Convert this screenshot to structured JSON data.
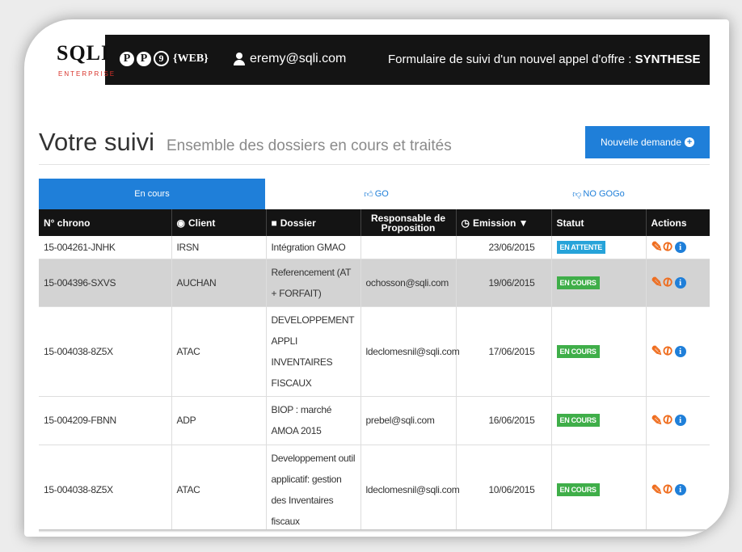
{
  "topbar": {
    "logo_text": "SQLI",
    "logo_sub": "ENTERPRISE",
    "app_logo": {
      "p1": "P",
      "p2": "P",
      "num": "9",
      "web": "{WEB}"
    },
    "user_email": "eremy@sqli.com",
    "form_title_prefix": "Formulaire de suivi d'un nouvel appel d'offre :",
    "form_title_bold": "SYNTHESE"
  },
  "header": {
    "title": "Votre suivi",
    "subtitle": "Ensemble des dossiers en cours et traités",
    "new_button": "Nouvelle demande"
  },
  "tabs": [
    {
      "label": "En cours",
      "icon": "",
      "active": true
    },
    {
      "label": "GO",
      "icon": "thumbs-up-icon",
      "active": false
    },
    {
      "label": "NO GOGo",
      "icon": "thumbs-down-icon",
      "active": false
    }
  ],
  "table": {
    "columns": [
      {
        "label": "N° chrono",
        "icon": ""
      },
      {
        "label": "Client",
        "icon": "eye-icon"
      },
      {
        "label": "Dossier",
        "icon": "briefcase-icon"
      },
      {
        "label": "Responsable de Proposition",
        "icon": ""
      },
      {
        "label": "Emission ▼",
        "icon": "clock-icon"
      },
      {
        "label": "Statut",
        "icon": ""
      },
      {
        "label": "Actions",
        "icon": ""
      }
    ],
    "rows": [
      {
        "chrono": "15-004261-JNHK",
        "client": "IRSN",
        "dossier": "Intégration GMAO",
        "responsable": "",
        "emission": "23/06/2015",
        "statut": "EN ATTENTE",
        "statut_color": "#26a3d9"
      },
      {
        "chrono": "15-004396-SXVS",
        "client": "AUCHAN",
        "dossier": "Referencement (AT + FORFAIT)",
        "responsable": "ochosson@sqli.com",
        "emission": "19/06/2015",
        "statut": "EN COURS",
        "statut_color": "#3fae49"
      },
      {
        "chrono": "15-004038-8Z5X",
        "client": "ATAC",
        "dossier": "DEVELOPPEMENT APPLI INVENTAIRES FISCAUX",
        "responsable": "ldeclomesnil@sqli.com",
        "emission": "17/06/2015",
        "statut": "EN COURS",
        "statut_color": "#3fae49"
      },
      {
        "chrono": "15-004209-FBNN",
        "client": "ADP",
        "dossier": "BIOP : marché AMOA 2015",
        "responsable": "prebel@sqli.com",
        "emission": "16/06/2015",
        "statut": "EN COURS",
        "statut_color": "#3fae49"
      },
      {
        "chrono": "15-004038-8Z5X",
        "client": "ATAC",
        "dossier": "Developpement outil applicatif: gestion des Inventaires fiscaux",
        "responsable": "ldeclomesnil@sqli.com",
        "emission": "10/06/2015",
        "statut": "EN COURS",
        "statut_color": "#3fae49"
      }
    ]
  },
  "colors": {
    "accent": "#1f7fd9",
    "topbar": "#141414",
    "action_orange": "#ef6c1d",
    "status_blue": "#26a3d9",
    "status_green": "#3fae49"
  }
}
